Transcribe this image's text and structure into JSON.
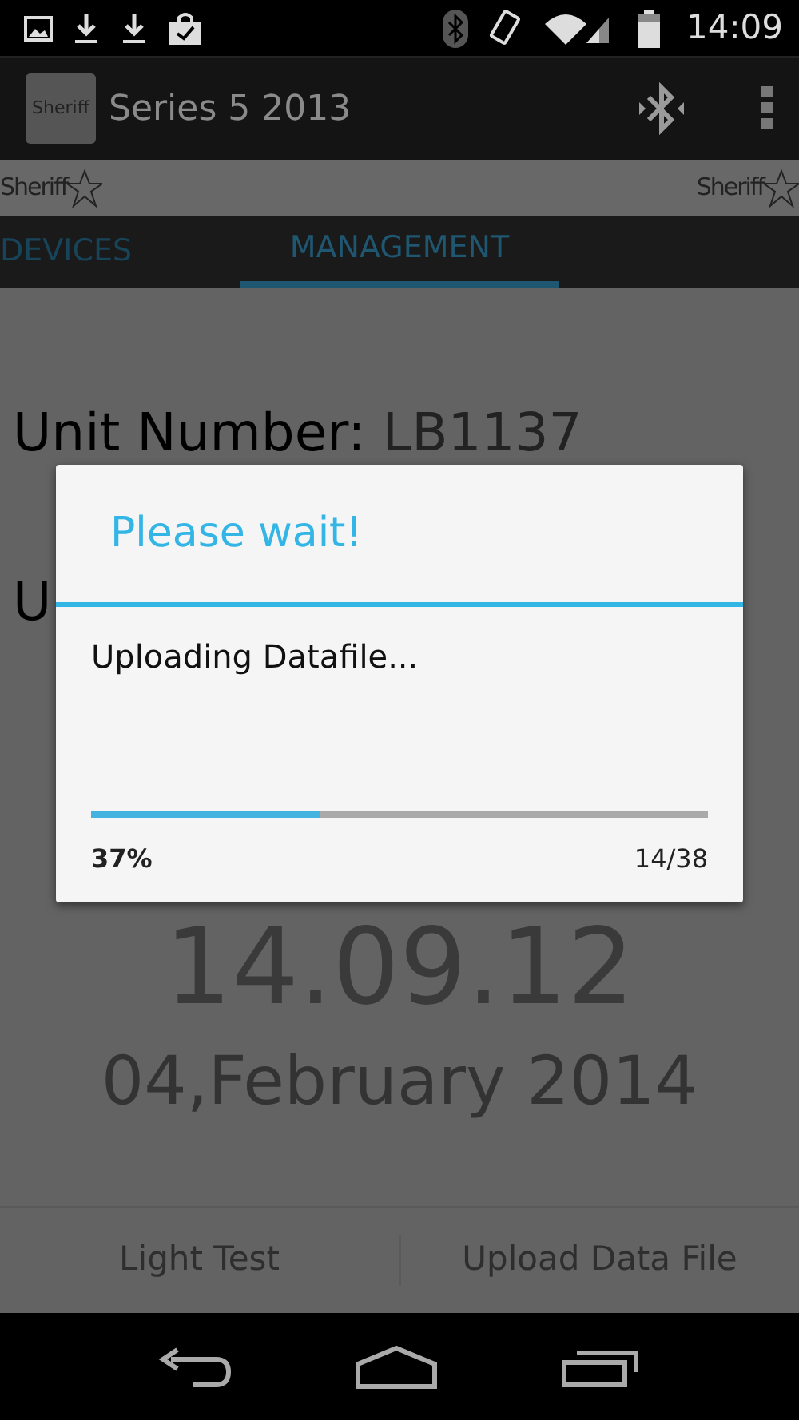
{
  "status_bar": {
    "time": "14:09"
  },
  "action_bar": {
    "logo_text": "Sheriff",
    "title": "Series 5 2013"
  },
  "banner": {
    "logos": [
      "Sheriff",
      "Sheriff"
    ]
  },
  "tabs": [
    {
      "label": "DEVICES",
      "selected": false
    },
    {
      "label": "MANAGEMENT",
      "selected": true
    }
  ],
  "content": {
    "unit_label": "Unit Number:",
    "unit_value": "LB1137",
    "second_label": "U",
    "time": "14.09.12",
    "date": "04,February 2014"
  },
  "buttons": [
    "Light Test",
    "Upload Data File"
  ],
  "dialog": {
    "title": "Please wait!",
    "message": "Uploading Datafile...",
    "progress": {
      "level": 0.37,
      "percent": "37%",
      "count": "14/38"
    }
  }
}
